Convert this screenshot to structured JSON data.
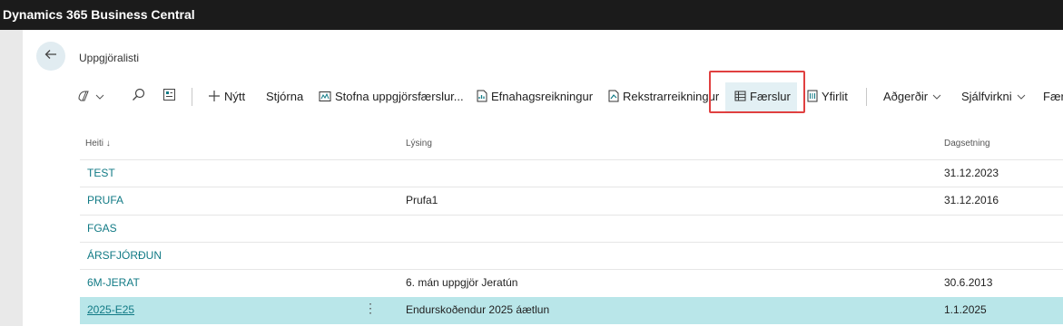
{
  "app": {
    "title": "Dynamics 365 Business Central"
  },
  "page": {
    "title": "Uppgjöralisti"
  },
  "actions": {
    "new": "Nýtt",
    "manage": "Stjórna",
    "create_entries": "Stofna uppgjörsfærslur...",
    "balance_sheet": "Efnahagsreikningur",
    "income_statement": "Rekstrarreikningur",
    "entries": "Færslur",
    "overview": "Yfirlit",
    "actions_menu": "Aðgerðir",
    "automate_menu": "Sjálfvirkni",
    "overflow": "Fær"
  },
  "table": {
    "columns": {
      "name": "Heiti ↓",
      "description": "Lýsing",
      "date": "Dagsetning"
    },
    "rows": [
      {
        "name": "TEST",
        "description": "",
        "date": "31.12.2023"
      },
      {
        "name": "PRUFA",
        "description": "Prufa1",
        "date": "31.12.2016"
      },
      {
        "name": "FGAS",
        "description": "",
        "date": ""
      },
      {
        "name": "ÁRSFJÓRÐUN",
        "description": "",
        "date": ""
      },
      {
        "name": "6M-JERAT",
        "description": "6. mán uppgjör Jeratún",
        "date": "30.6.2013"
      },
      {
        "name": "2025-E25",
        "description": "Endurskoðendur 2025 áætlun",
        "date": "1.1.2025",
        "selected": true
      }
    ]
  },
  "colors": {
    "accent": "#117a85",
    "selected_row": "#b9e6e9",
    "highlight_box": "#e04040",
    "topbar": "#1b1b1b"
  }
}
